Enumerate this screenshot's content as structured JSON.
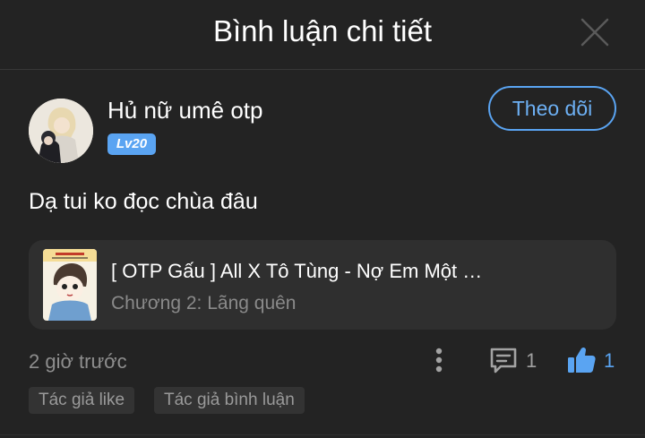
{
  "header": {
    "title": "Bình luận chi tiết",
    "close_icon": "close-icon"
  },
  "comment": {
    "username": "Hủ nữ umê otp",
    "level": "Lv20",
    "follow_label": "Theo dõi",
    "text": "Dạ tui ko đọc chùa đâu",
    "timestamp": "2 giờ trước",
    "reply_count": "1",
    "like_count": "1"
  },
  "story": {
    "title": "[ OTP Gấu ] All X Tô Tùng - Nợ Em Một Đời",
    "chapter": "Chương 2: Lãng quên"
  },
  "tags": [
    "Tác giả like",
    "Tác giả bình luận"
  ],
  "colors": {
    "background": "#232323",
    "card": "#2f2f2f",
    "accent": "#5aa4f2",
    "muted_text": "#8e8e8e"
  }
}
